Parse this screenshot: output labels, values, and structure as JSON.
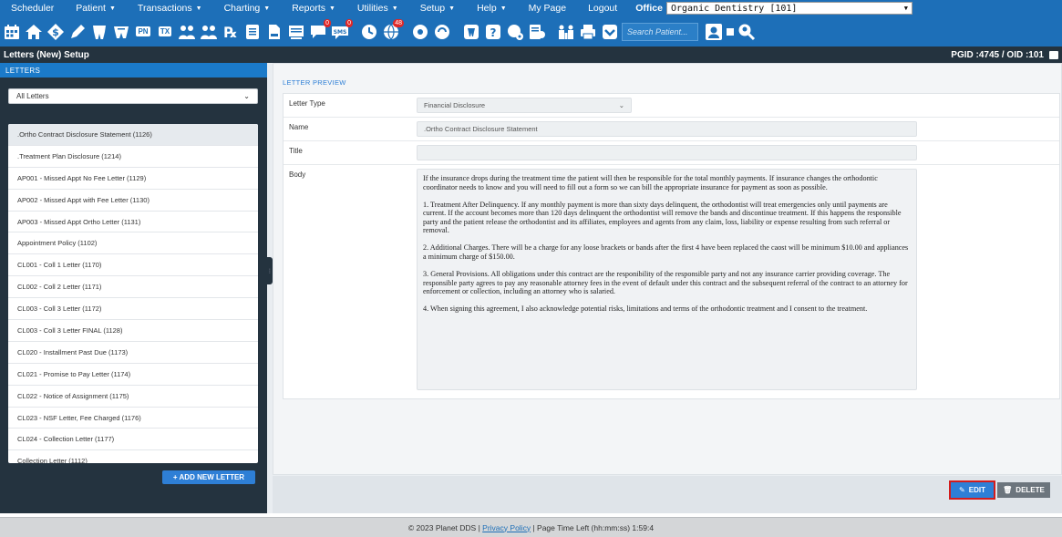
{
  "menu": {
    "items": [
      {
        "label": "Scheduler",
        "caret": false
      },
      {
        "label": "Patient",
        "caret": true
      },
      {
        "label": "Transactions",
        "caret": true
      },
      {
        "label": "Charting",
        "caret": true
      },
      {
        "label": "Reports",
        "caret": true
      },
      {
        "label": "Utilities",
        "caret": true
      },
      {
        "label": "Setup",
        "caret": true
      },
      {
        "label": "Help",
        "caret": true
      },
      {
        "label": "My Page",
        "caret": false
      },
      {
        "label": "Logout",
        "caret": false
      }
    ],
    "office_label": "Office",
    "office_value": "Organic Dentistry [101]"
  },
  "toolbar": {
    "search_placeholder": "Search Patient...",
    "badges": {
      "mail": "0",
      "sms": "0",
      "clock": "48"
    },
    "text_icons": {
      "pn": "PN",
      "tx": "TX"
    }
  },
  "titlebar": {
    "title": "Letters (New) Setup",
    "ids": "PGID :4745 / OID :101"
  },
  "left": {
    "header": "LETTERS",
    "filter_value": "All Letters",
    "letters": [
      ".Ortho Contract Disclosure Statement (1126)",
      ".Treatment Plan Disclosure (1214)",
      "AP001 - Missed Appt No Fee Letter (1129)",
      "AP002 - Missed Appt with Fee Letter (1130)",
      "AP003 - Missed Appt Ortho Letter (1131)",
      "Appointment Policy (1102)",
      "CL001 - Coll 1 Letter (1170)",
      "CL002 - Coll 2 Letter (1171)",
      "CL003 - Coll 3 Letter (1172)",
      "CL003 - Coll 3 Letter FINAL (1128)",
      "CL020 - Installment Past Due (1173)",
      "CL021 - Promise to Pay Letter (1174)",
      "CL022 - Notice of Assignment (1175)",
      "CL023 - NSF Letter, Fee Charged (1176)",
      "CL024 - Collection Letter (1177)",
      "Collection Letter (1112)"
    ],
    "add_button": "+ ADD NEW LETTER"
  },
  "preview": {
    "section_title": "LETTER PREVIEW",
    "labels": {
      "type": "Letter Type",
      "name": "Name",
      "title": "Title",
      "body": "Body"
    },
    "type_value": "Financial Disclosure",
    "name_value": ".Ortho Contract Disclosure Statement",
    "title_value": "",
    "body_paragraphs": [
      "If the insurance drops during the treatment time the patient will then be responsible for the total monthly payments. If insurance changes the orthodontic coordinator needs to know and you will need to fill out a form so we can bill the appropriate insurance for payment as soon as possible.",
      "1. Treatment After Delinquency. If any monthly payment is more than sixty days delinquent, the orthodontist will treat emergencies only until payments are current. If the account becomes more than 120 days delinquent the orthodontist will remove the bands and discontinue treatment. If this happens the responsible party and the patient release the orthodontist and its affiliates, employees and agents from any claim, loss, liability or expense resulting from such referral or removal.",
      "2. Additional Charges. There will be a charge for any loose brackets or bands after the first 4 have been replaced the caost will be minimum $10.00 and appliances a minimum charge of $150.00.",
      "3. General Provisions. All obligations under this contract are the responibility of the responsible party and not any insurance carrier providing coverage. The responsible party agrees to pay any reasonable attorney fees in the event of default under this contract and the subsequent referral of the contract to an attorney for enforcement or collection, including an attorney who is salaried.",
      "4. When signing this agreement, I also acknowledge potential risks, limitations and terms of the orthodontic treatment and I consent to the treatment."
    ],
    "edit_label": "EDIT",
    "delete_label": "DELETE"
  },
  "footer": {
    "copyright": "© 2023 Planet DDS |",
    "privacy": "Privacy Policy",
    "time_left": "| Page Time Left (hh:mm:ss) 1:59:4"
  }
}
